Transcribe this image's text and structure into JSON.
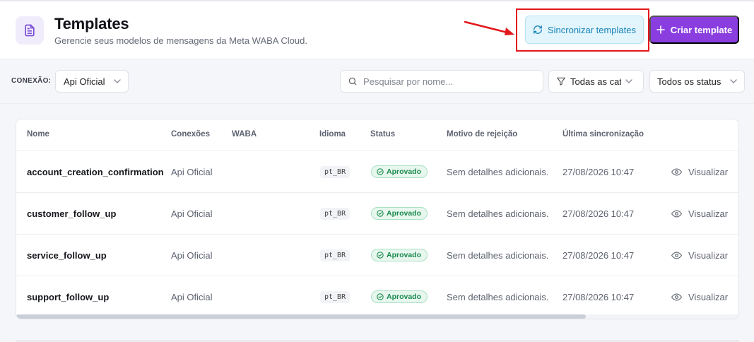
{
  "header": {
    "title": "Templates",
    "subtitle": "Gerencie seus modelos de mensagens da Meta WABA Cloud.",
    "icon": "document-icon",
    "sync_label": "Sincronizar templates",
    "create_label": "Criar template"
  },
  "filters": {
    "connection_label": "CONEXÃO:",
    "connection_value": "Api Oficial",
    "search_placeholder": "Pesquisar por nome...",
    "category_value": "Todas as categorias",
    "status_value": "Todos os status"
  },
  "table": {
    "columns": [
      "Nome",
      "Conexões",
      "WABA",
      "Idioma",
      "Status",
      "Motivo de rejeição",
      "Última sincronização"
    ],
    "view_label": "Visualizar",
    "rows": [
      {
        "name": "account_creation_confirmation",
        "connection": "Api Oficial",
        "waba": "",
        "language": "pt_BR",
        "status": "Aprovado",
        "reason": "Sem detalhes adicionais.",
        "last_sync": "27/08/2026 10:47"
      },
      {
        "name": "customer_follow_up",
        "connection": "Api Oficial",
        "waba": "",
        "language": "pt_BR",
        "status": "Aprovado",
        "reason": "Sem detalhes adicionais.",
        "last_sync": "27/08/2026 10:47"
      },
      {
        "name": "service_follow_up",
        "connection": "Api Oficial",
        "waba": "",
        "language": "pt_BR",
        "status": "Aprovado",
        "reason": "Sem detalhes adicionais.",
        "last_sync": "27/08/2026 10:47"
      },
      {
        "name": "support_follow_up",
        "connection": "Api Oficial",
        "waba": "",
        "language": "pt_BR",
        "status": "Aprovado",
        "reason": "Sem detalhes adicionais.",
        "last_sync": "27/08/2026 10:47"
      }
    ]
  },
  "colors": {
    "primary": "#8a3ee0",
    "sync_accent": "#1483b6",
    "highlight": "#e3171c",
    "approved": "#1c8a4e"
  }
}
